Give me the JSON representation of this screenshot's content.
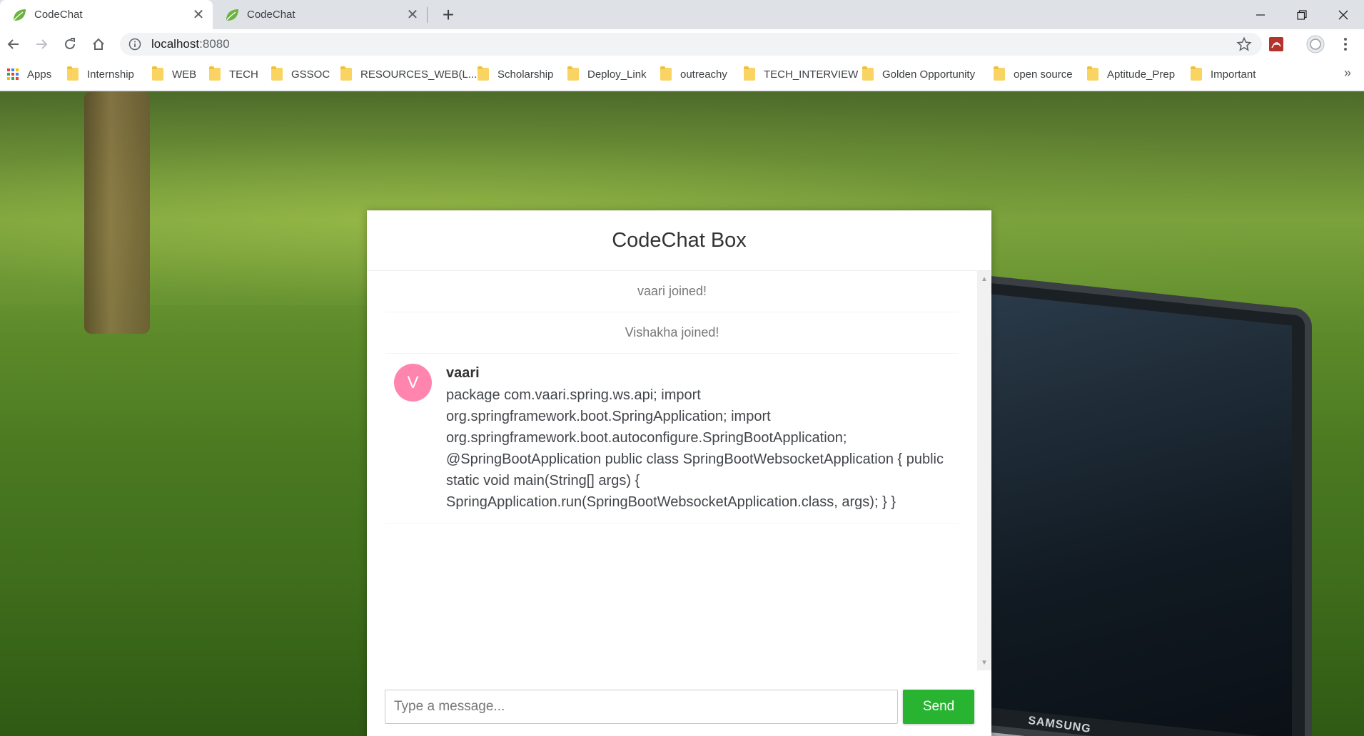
{
  "browser": {
    "tabs": [
      {
        "title": "CodeChat",
        "active": true
      },
      {
        "title": "CodeChat",
        "active": false
      }
    ],
    "url_host": "localhost",
    "url_port": ":8080",
    "bookmarks": [
      {
        "label": "Apps",
        "icon": "apps-grid-icon"
      },
      {
        "label": "Internship",
        "icon": "folder-icon"
      },
      {
        "label": "WEB",
        "icon": "folder-icon"
      },
      {
        "label": "TECH",
        "icon": "folder-icon"
      },
      {
        "label": "GSSOC",
        "icon": "folder-icon"
      },
      {
        "label": "RESOURCES_WEB(L...",
        "icon": "folder-icon"
      },
      {
        "label": "Scholarship",
        "icon": "folder-icon"
      },
      {
        "label": "Deploy_Link",
        "icon": "folder-icon"
      },
      {
        "label": "outreachy",
        "icon": "folder-icon"
      },
      {
        "label": "TECH_INTERVIEW",
        "icon": "folder-icon"
      },
      {
        "label": "Golden Opportunity",
        "icon": "folder-icon"
      },
      {
        "label": "open source",
        "icon": "folder-icon"
      },
      {
        "label": "Aptitude_Prep",
        "icon": "folder-icon"
      },
      {
        "label": "Important",
        "icon": "folder-icon"
      }
    ],
    "bookmarks_overflow": "»"
  },
  "chat": {
    "title": "CodeChat Box",
    "events": [
      "vaari joined!",
      "Vishakha joined!"
    ],
    "messages": [
      {
        "avatar_letter": "V",
        "avatar_color": "#ff85af",
        "sender": "vaari",
        "text": "package com.vaari.spring.ws.api; import org.springframework.boot.SpringApplication; import org.springframework.boot.autoconfigure.SpringBootApplication; @SpringBootApplication public class SpringBootWebsocketApplication { public static void main(String[] args) { SpringApplication.run(SpringBootWebsocketApplication.class, args); } }"
      }
    ],
    "input_placeholder": "Type a message...",
    "send_label": "Send",
    "send_color": "#28b331"
  },
  "background": {
    "laptop_brand": "SAMSUNG"
  }
}
